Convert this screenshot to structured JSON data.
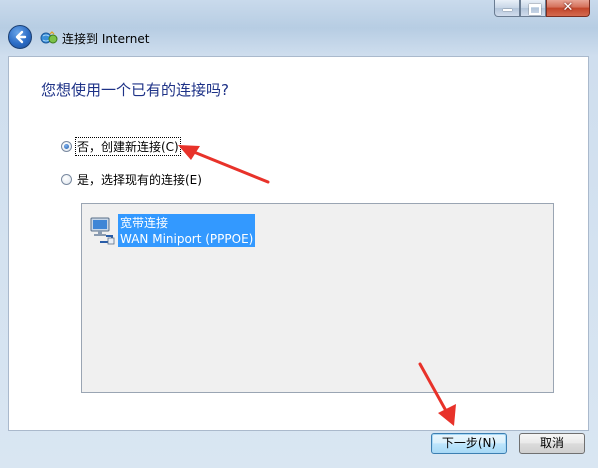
{
  "window": {
    "title": "连接到 Internet",
    "close_glyph": "✕"
  },
  "page": {
    "heading": "您想使用一个已有的连接吗?"
  },
  "options": [
    {
      "label": "否，创建新连接(C)",
      "checked": true
    },
    {
      "label": "是，选择现有的连接(E)",
      "checked": false
    }
  ],
  "connections": [
    {
      "name": "宽带连接",
      "device": "WAN Miniport (PPPOE)",
      "selected": true,
      "icon": "network-connection-icon"
    }
  ],
  "buttons": {
    "next": "下一步(N)",
    "cancel": "取消"
  },
  "colors": {
    "heading": "#1e3287",
    "selection": "#3399ff",
    "annotation_arrow": "#e8322a"
  }
}
